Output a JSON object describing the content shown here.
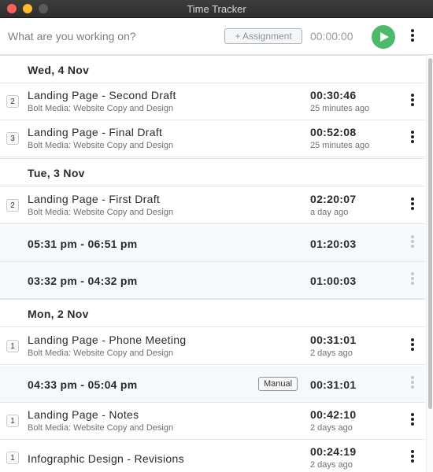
{
  "window": {
    "title": "Time Tracker"
  },
  "toolbar": {
    "task_placeholder": "What are you working on?",
    "assignment_label": "+ Assignment",
    "timer": "00:00:00"
  },
  "days": [
    {
      "label": "Wed, 4 Nov",
      "entries": [
        {
          "count": "2",
          "title": "Landing Page - Second Draft",
          "project": "Bolt Media: Website Copy and Design",
          "duration": "00:30:46",
          "ago": "25 minutes ago"
        },
        {
          "count": "3",
          "title": "Landing Page - Final Draft",
          "project": "Bolt Media: Website Copy and Design",
          "duration": "00:52:08",
          "ago": "25 minutes ago"
        }
      ]
    },
    {
      "label": "Tue, 3 Nov",
      "entries": [
        {
          "count": "2",
          "title": "Landing Page - First Draft",
          "project": "Bolt Media: Website Copy and Design",
          "duration": "02:20:07",
          "ago": "a day ago"
        }
      ],
      "sessions": [
        {
          "range": "05:31 pm - 06:51 pm",
          "duration": "01:20:03"
        },
        {
          "range": "03:32 pm - 04:32 pm",
          "duration": "01:00:03"
        }
      ]
    },
    {
      "label": "Mon, 2 Nov",
      "entries": [
        {
          "count": "1",
          "title": "Landing Page - Phone Meeting",
          "project": "Bolt Media: Website Copy and Design",
          "duration": "00:31:01",
          "ago": "2 days ago"
        },
        {
          "count": "1",
          "title": "Landing Page - Notes",
          "project": "Bolt Media: Website Copy and Design",
          "duration": "00:42:10",
          "ago": "2 days ago"
        },
        {
          "count": "1",
          "title": "Infographic Design - Revisions",
          "project": "",
          "duration": "00:24:19",
          "ago": "2 days ago"
        }
      ],
      "sessions": [
        {
          "range": "04:33 pm - 05:04 pm",
          "duration": "00:31:01",
          "badge": "Manual"
        }
      ]
    }
  ],
  "colors": {
    "play": "#4bba6a",
    "session_bg": "#f6f9fc",
    "divider": "#e4e6e8"
  },
  "icons": [
    "play-icon",
    "more-vertical-icon"
  ]
}
